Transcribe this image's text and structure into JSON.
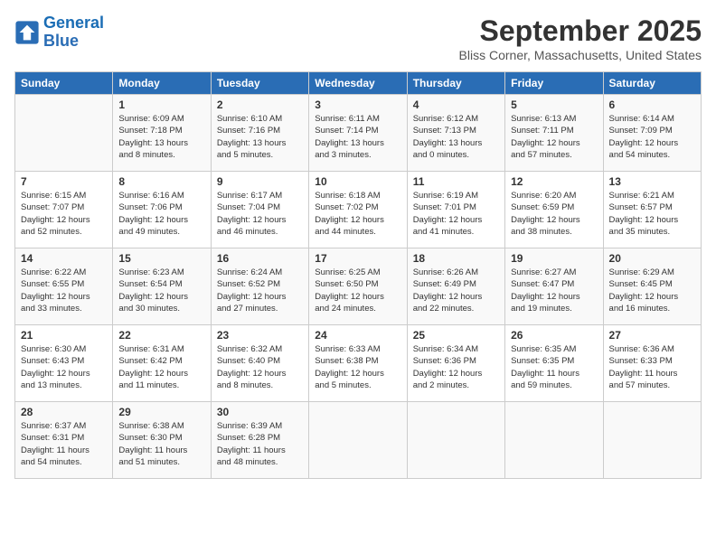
{
  "logo": {
    "line1": "General",
    "line2": "Blue"
  },
  "title": "September 2025",
  "location": "Bliss Corner, Massachusetts, United States",
  "weekdays": [
    "Sunday",
    "Monday",
    "Tuesday",
    "Wednesday",
    "Thursday",
    "Friday",
    "Saturday"
  ],
  "weeks": [
    [
      {
        "day": "",
        "text": ""
      },
      {
        "day": "1",
        "text": "Sunrise: 6:09 AM\nSunset: 7:18 PM\nDaylight: 13 hours\nand 8 minutes."
      },
      {
        "day": "2",
        "text": "Sunrise: 6:10 AM\nSunset: 7:16 PM\nDaylight: 13 hours\nand 5 minutes."
      },
      {
        "day": "3",
        "text": "Sunrise: 6:11 AM\nSunset: 7:14 PM\nDaylight: 13 hours\nand 3 minutes."
      },
      {
        "day": "4",
        "text": "Sunrise: 6:12 AM\nSunset: 7:13 PM\nDaylight: 13 hours\nand 0 minutes."
      },
      {
        "day": "5",
        "text": "Sunrise: 6:13 AM\nSunset: 7:11 PM\nDaylight: 12 hours\nand 57 minutes."
      },
      {
        "day": "6",
        "text": "Sunrise: 6:14 AM\nSunset: 7:09 PM\nDaylight: 12 hours\nand 54 minutes."
      }
    ],
    [
      {
        "day": "7",
        "text": "Sunrise: 6:15 AM\nSunset: 7:07 PM\nDaylight: 12 hours\nand 52 minutes."
      },
      {
        "day": "8",
        "text": "Sunrise: 6:16 AM\nSunset: 7:06 PM\nDaylight: 12 hours\nand 49 minutes."
      },
      {
        "day": "9",
        "text": "Sunrise: 6:17 AM\nSunset: 7:04 PM\nDaylight: 12 hours\nand 46 minutes."
      },
      {
        "day": "10",
        "text": "Sunrise: 6:18 AM\nSunset: 7:02 PM\nDaylight: 12 hours\nand 44 minutes."
      },
      {
        "day": "11",
        "text": "Sunrise: 6:19 AM\nSunset: 7:01 PM\nDaylight: 12 hours\nand 41 minutes."
      },
      {
        "day": "12",
        "text": "Sunrise: 6:20 AM\nSunset: 6:59 PM\nDaylight: 12 hours\nand 38 minutes."
      },
      {
        "day": "13",
        "text": "Sunrise: 6:21 AM\nSunset: 6:57 PM\nDaylight: 12 hours\nand 35 minutes."
      }
    ],
    [
      {
        "day": "14",
        "text": "Sunrise: 6:22 AM\nSunset: 6:55 PM\nDaylight: 12 hours\nand 33 minutes."
      },
      {
        "day": "15",
        "text": "Sunrise: 6:23 AM\nSunset: 6:54 PM\nDaylight: 12 hours\nand 30 minutes."
      },
      {
        "day": "16",
        "text": "Sunrise: 6:24 AM\nSunset: 6:52 PM\nDaylight: 12 hours\nand 27 minutes."
      },
      {
        "day": "17",
        "text": "Sunrise: 6:25 AM\nSunset: 6:50 PM\nDaylight: 12 hours\nand 24 minutes."
      },
      {
        "day": "18",
        "text": "Sunrise: 6:26 AM\nSunset: 6:49 PM\nDaylight: 12 hours\nand 22 minutes."
      },
      {
        "day": "19",
        "text": "Sunrise: 6:27 AM\nSunset: 6:47 PM\nDaylight: 12 hours\nand 19 minutes."
      },
      {
        "day": "20",
        "text": "Sunrise: 6:29 AM\nSunset: 6:45 PM\nDaylight: 12 hours\nand 16 minutes."
      }
    ],
    [
      {
        "day": "21",
        "text": "Sunrise: 6:30 AM\nSunset: 6:43 PM\nDaylight: 12 hours\nand 13 minutes."
      },
      {
        "day": "22",
        "text": "Sunrise: 6:31 AM\nSunset: 6:42 PM\nDaylight: 12 hours\nand 11 minutes."
      },
      {
        "day": "23",
        "text": "Sunrise: 6:32 AM\nSunset: 6:40 PM\nDaylight: 12 hours\nand 8 minutes."
      },
      {
        "day": "24",
        "text": "Sunrise: 6:33 AM\nSunset: 6:38 PM\nDaylight: 12 hours\nand 5 minutes."
      },
      {
        "day": "25",
        "text": "Sunrise: 6:34 AM\nSunset: 6:36 PM\nDaylight: 12 hours\nand 2 minutes."
      },
      {
        "day": "26",
        "text": "Sunrise: 6:35 AM\nSunset: 6:35 PM\nDaylight: 11 hours\nand 59 minutes."
      },
      {
        "day": "27",
        "text": "Sunrise: 6:36 AM\nSunset: 6:33 PM\nDaylight: 11 hours\nand 57 minutes."
      }
    ],
    [
      {
        "day": "28",
        "text": "Sunrise: 6:37 AM\nSunset: 6:31 PM\nDaylight: 11 hours\nand 54 minutes."
      },
      {
        "day": "29",
        "text": "Sunrise: 6:38 AM\nSunset: 6:30 PM\nDaylight: 11 hours\nand 51 minutes."
      },
      {
        "day": "30",
        "text": "Sunrise: 6:39 AM\nSunset: 6:28 PM\nDaylight: 11 hours\nand 48 minutes."
      },
      {
        "day": "",
        "text": ""
      },
      {
        "day": "",
        "text": ""
      },
      {
        "day": "",
        "text": ""
      },
      {
        "day": "",
        "text": ""
      }
    ]
  ]
}
